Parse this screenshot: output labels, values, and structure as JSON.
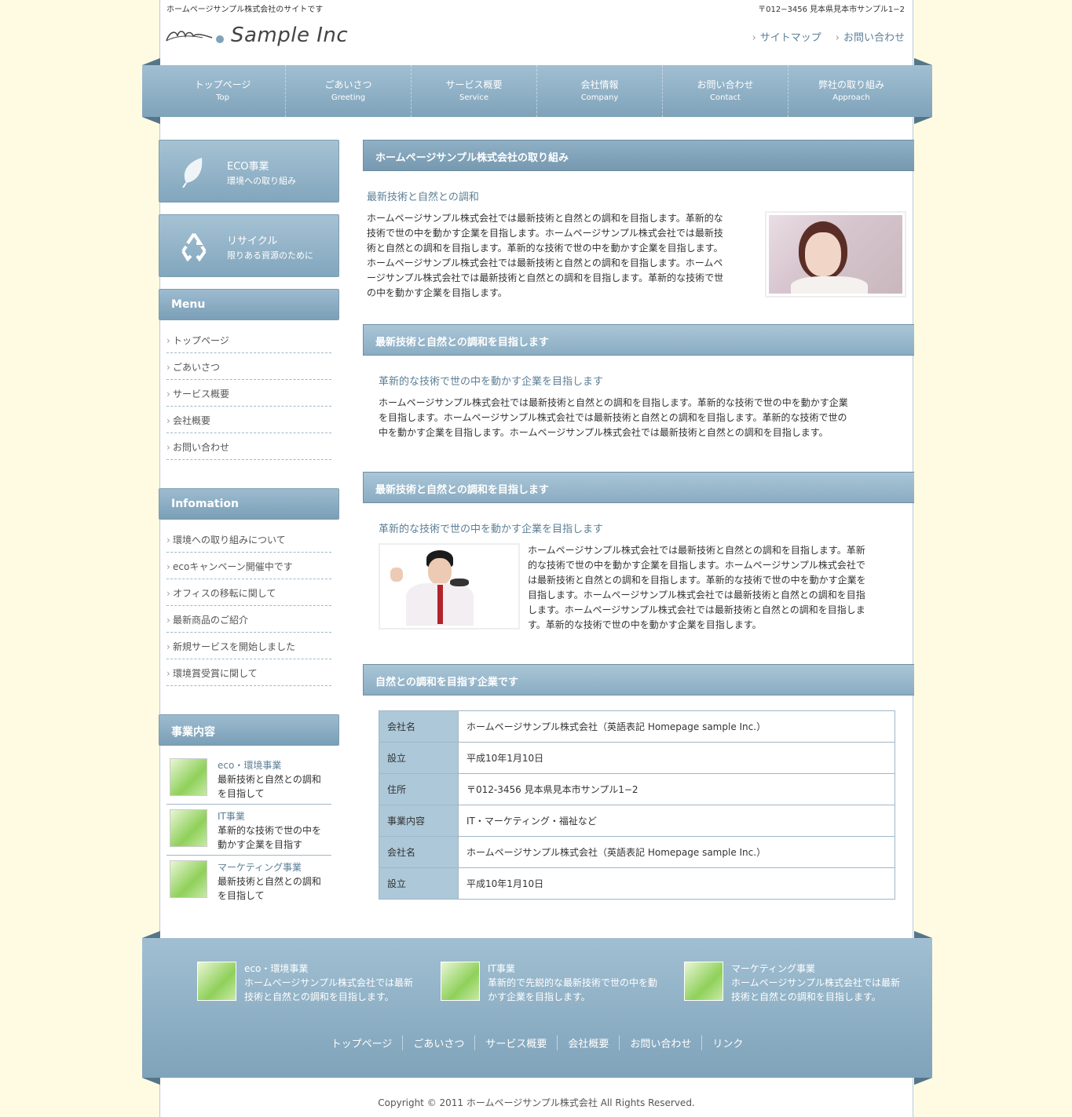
{
  "header": {
    "tagline": "ホームページサンプル株式会社のサイトです",
    "address": "〒012−3456 見本県見本市サンプル1−2",
    "logo_text": "Sample Inc",
    "links": [
      "サイトマップ",
      "お問い合わせ"
    ]
  },
  "gnav": [
    {
      "jp": "トップページ",
      "en": "Top"
    },
    {
      "jp": "ごあいさつ",
      "en": "Greeting"
    },
    {
      "jp": "サービス概要",
      "en": "Service"
    },
    {
      "jp": "会社情報",
      "en": "Company"
    },
    {
      "jp": "お問い合わせ",
      "en": "Contact"
    },
    {
      "jp": "弊社の取り組み",
      "en": "Approach"
    }
  ],
  "side": {
    "banners": [
      {
        "title": "ECO事業",
        "sub": "環境への取り組み"
      },
      {
        "title": "リサイクル",
        "sub": "限りある資源のために"
      }
    ],
    "menu_title": "Menu",
    "menu": [
      "トップページ",
      "ごあいさつ",
      "サービス概要",
      "会社概要",
      "お問い合わせ"
    ],
    "info_title": "Infomation",
    "info": [
      "環境への取り組みについて",
      "ecoキャンペーン開催中です",
      "オフィスの移転に関して",
      "最新商品のご紹介",
      "新規サービスを開始しました",
      "環境賞受賞に関して"
    ],
    "biz_title": "事業内容",
    "biz": [
      {
        "title": "eco・環境事業",
        "l1": "最新技術と自然との調和",
        "l2": "を目指して"
      },
      {
        "title": "IT事業",
        "l1": "革新的な技術で世の中を",
        "l2": "動かす企業を目指す"
      },
      {
        "title": "マーケティング事業",
        "l1": "最新技術と自然との調和",
        "l2": "を目指して"
      }
    ]
  },
  "main": {
    "s1": {
      "heading": "ホームページサンプル株式会社の取り組み",
      "sub": "最新技術と自然との調和",
      "lines": [
        "ホームページサンプル株式会社では最新技術と自然との調和を目指します。革新的な",
        "技術で世の中を動かす企業を目指します。ホームページサンプル株式会社では最新技",
        "術と自然との調和を目指します。革新的な技術で世の中を動かす企業を目指します。",
        "ホームページサンプル株式会社では最新技術と自然との調和を目指します。ホームペ",
        "ージサンプル株式会社では最新技術と自然との調和を目指します。革新的な技術で世",
        "の中を動かす企業を目指します。"
      ]
    },
    "s2": {
      "heading": "最新技術と自然との調和を目指します",
      "sub": "革新的な技術で世の中を動かす企業を目指します",
      "lines": [
        "ホームページサンプル株式会社では最新技術と自然との調和を目指します。革新的な技術で世の中を動かす企業",
        "を目指します。ホームページサンプル株式会社では最新技術と自然との調和を目指します。革新的な技術で世の",
        "中を動かす企業を目指します。ホームページサンプル株式会社では最新技術と自然との調和を目指します。"
      ]
    },
    "s3": {
      "heading": "最新技術と自然との調和を目指します",
      "sub": "革新的な技術で世の中を動かす企業を目指します",
      "lines": [
        "ホームページサンプル株式会社では最新技術と自然との調和を目指します。革新",
        "的な技術で世の中を動かす企業を目指します。ホームページサンプル株式会社で",
        "は最新技術と自然との調和を目指します。革新的な技術で世の中を動かす企業を",
        "目指します。ホームページサンプル株式会社では最新技術と自然との調和を目指",
        "します。ホームページサンプル株式会社では最新技術と自然との調和を目指しま",
        "す。革新的な技術で世の中を動かす企業を目指します。"
      ]
    },
    "s4": {
      "heading": "自然との調和を目指す企業です",
      "table": [
        {
          "k": "会社名",
          "v": "ホームページサンプル株式会社（英語表記 Homepage sample Inc.）"
        },
        {
          "k": "設立",
          "v": "平成10年1月10日"
        },
        {
          "k": "住所",
          "v": "〒012-3456 見本県見本市サンプル1−2"
        },
        {
          "k": "事業内容",
          "v": "IT・マーケティング・福祉など"
        },
        {
          "k": "会社名",
          "v": "ホームページサンプル株式会社（英語表記 Homepage sample Inc.）"
        },
        {
          "k": "設立",
          "v": "平成10年1月10日"
        }
      ]
    }
  },
  "footer": {
    "biz": [
      {
        "title": "eco・環境事業",
        "l1": "ホームページサンプル株式会社では最新",
        "l2": "技術と自然との調和を目指します。"
      },
      {
        "title": "IT事業",
        "l1": "革新的で先鋭的な最新技術で世の中を動",
        "l2": "かす企業を目指します。"
      },
      {
        "title": "マーケティング事業",
        "l1": "ホームページサンプル株式会社では最新",
        "l2": "技術と自然との調和を目指します。"
      }
    ],
    "nav": [
      "トップページ",
      "ごあいさつ",
      "サービス概要",
      "会社概要",
      "お問い合わせ",
      "リンク"
    ],
    "copyright": "Copyright © 2011 ホームページサンプル株式会社 All Rights Reserved."
  },
  "colors": {
    "accent": "#7fa3ba",
    "link": "#5c7f96",
    "background": "#fffbe3"
  }
}
